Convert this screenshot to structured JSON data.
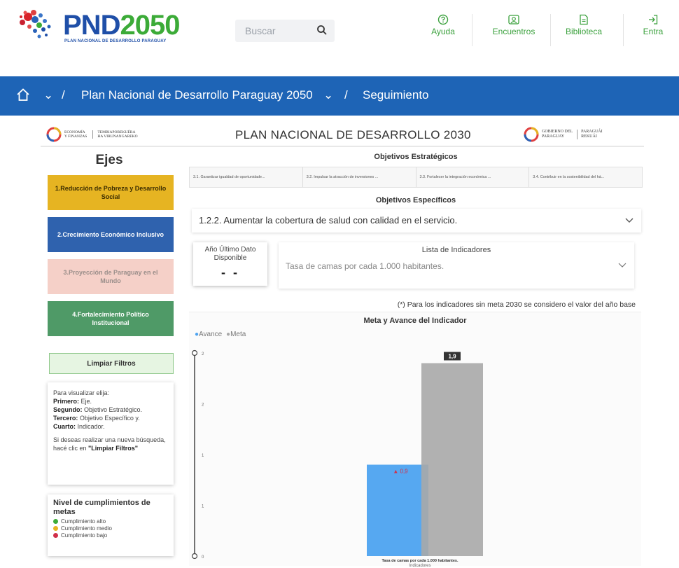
{
  "header": {
    "logo_text_prefix": "PND",
    "logo_text_num": "2050",
    "logo_subtitle": "PLAN NACIONAL DE DESARROLLO PARAGUAY",
    "search_placeholder": "Buscar",
    "nav": [
      {
        "label": "Ayuda",
        "icon": "help-icon"
      },
      {
        "label": "Encuentros",
        "icon": "encuentros-icon"
      },
      {
        "label": "Biblioteca",
        "icon": "library-icon"
      },
      {
        "label": "Entra",
        "icon": "login-icon"
      }
    ],
    "accent_color": "#3ba13d",
    "brand_color": "#1f4fa8"
  },
  "breadcrumb": {
    "items": [
      "Plan Nacional de Desarrollo Paraguay 2050",
      "Seguimiento"
    ],
    "bar_color": "#1e64b6"
  },
  "report": {
    "title": "PLAN NACIONAL DE DESARROLLO 2030",
    "left_logo": {
      "line1": "ECONOMÍA",
      "line2": "Y FINANZAS",
      "line3": "TEMBIAPOREKUÉRA",
      "line4": "HA VIRUNANGAREKO"
    },
    "right_logo": {
      "line1": "GOBIERNO DEL",
      "line2": "PARAGUAY",
      "line3": "PARAGUÁI",
      "line4": "REKUÁI"
    },
    "ejes": {
      "title": "Ejes",
      "items": [
        {
          "label": "1.Reducción de Pobreza y Desarrollo Social",
          "color": "#e6b422",
          "text_color": "#3a2c00"
        },
        {
          "label": "2.Crecimiento Económico Inclusivo",
          "color": "#2f62ae",
          "text_color": "#ffffff"
        },
        {
          "label": "3.Proyección de Paraguay en el Mundo",
          "color": "#f5d0c8",
          "text_color": "#9a8e8a"
        },
        {
          "label": "4.Fortalecimiento Político Institucional",
          "color": "#4f9a67",
          "text_color": "#ffffff"
        }
      ]
    },
    "clear_filters": "Limpiar Filtros",
    "instructions": {
      "intro": "Para visualizar elija:",
      "steps": [
        {
          "k": "Primero:",
          "v": "Eje."
        },
        {
          "k": "Segundo:",
          "v": "Objetivo Estratégico."
        },
        {
          "k": "Tercero:",
          "v": "Objetivo Específico y."
        },
        {
          "k": "Cuarto:",
          "v": "Indicador."
        }
      ],
      "note_pre": "Si deseas realizar una nueva búsqueda, hacé clic en ",
      "note_bold": "\"Limpiar Filtros\""
    },
    "legend": {
      "title": "Nivel de cumplimientos de metas",
      "items": [
        {
          "label": "Cumplimiento alto",
          "color": "#3cab38"
        },
        {
          "label": "Cumplimiento medio",
          "color": "#e6b422"
        },
        {
          "label": "Cumplimiento bajo",
          "color": "#d0304a"
        }
      ]
    },
    "objetivos_estrategicos": {
      "title": "Objetivos Estratégicos",
      "tabs": [
        "3.1. Garantizar igualdad de oportunidade...",
        "3.2. Impulsar la atracción de inversiones ...",
        "3.3. Fortalecer la integración económica ...",
        "3.4. Contribuir en la sostenibilidad del há..."
      ]
    },
    "objetivos_especificos": {
      "title": "Objetivos Específicos",
      "selected": "1.2.2. Aumentar la cobertura de salud con calidad en el servicio."
    },
    "ano_ultimo_dato": {
      "label": "Año Último Dato Disponible",
      "value": "- -"
    },
    "indicadores": {
      "label": "Lista de Indicadores",
      "selected": "Tasa de camas por cada 1.000 habitantes."
    },
    "note": "(*) Para los indicadores sin meta 2030 se considero el valor del año base"
  },
  "chart_data": {
    "type": "bar",
    "title": "Meta y Avance del Indicador",
    "categories": [
      "Tasa de camas por cada 1.000 habitantes."
    ],
    "xlabel": "Indicadores",
    "ylabel": "",
    "ylim": [
      0,
      2
    ],
    "yticks": [
      "0",
      "1",
      "1",
      "2",
      "2"
    ],
    "series": [
      {
        "name": "Avance",
        "values": [
          0.9
        ],
        "color": "#4da3f0",
        "label": "▲ 0,9",
        "label_color": "#d0304a"
      },
      {
        "name": "Meta",
        "values": [
          1.9
        ],
        "color": "#a9a9a9",
        "label": "1,9"
      }
    ],
    "legend": "top-left",
    "grid": false
  }
}
